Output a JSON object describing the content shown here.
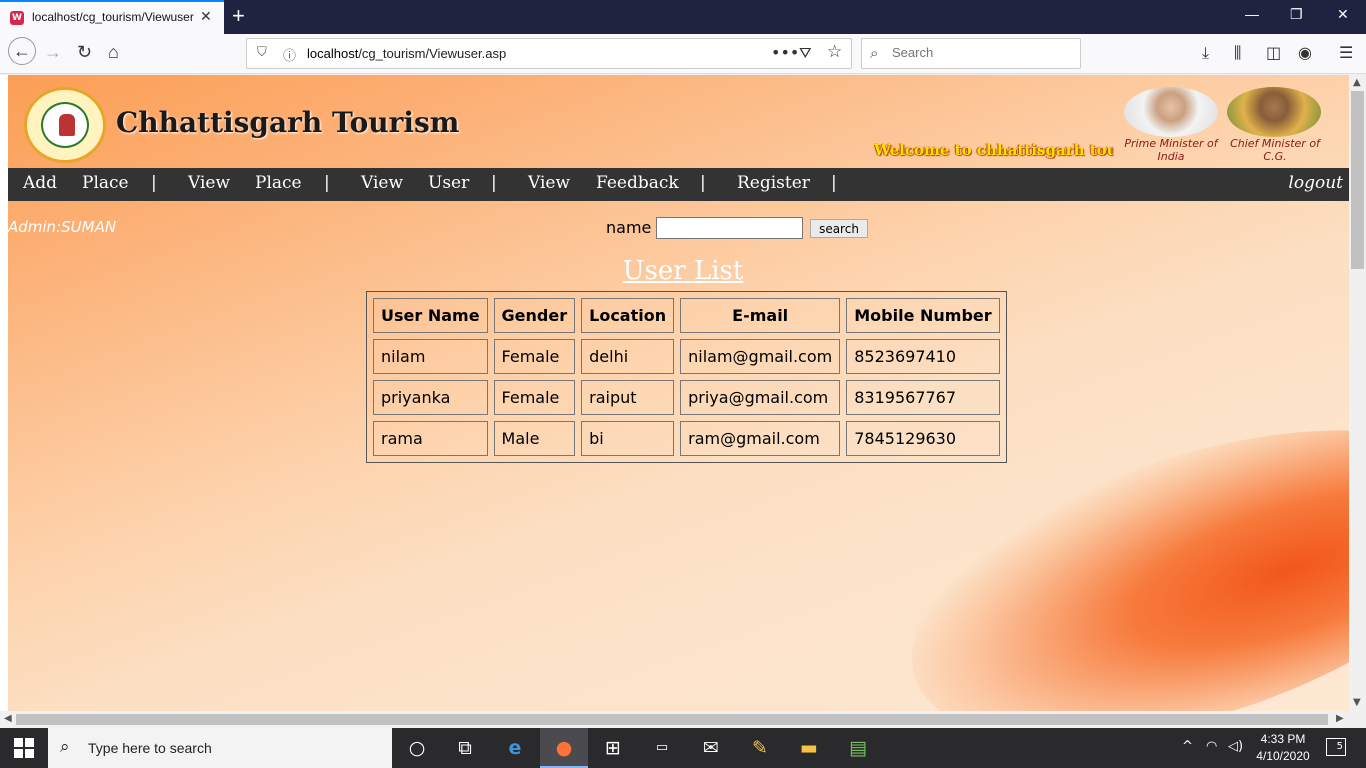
{
  "browser": {
    "tab_title": "localhost/cg_tourism/Viewuser.asp",
    "new_tab": "+",
    "url_host": "localhost",
    "url_path": "/cg_tourism/Viewuser.asp",
    "search_placeholder": "Search"
  },
  "page": {
    "site_title": "Chhattisgarh Tourism",
    "welcome_marquee": "Welcome to chhattisgarh tourism",
    "pm_caption": "Prime Minister of India",
    "cm_caption": "Chief Minister of C.G.",
    "menu": [
      {
        "label": "Add"
      },
      {
        "label": "Place"
      },
      {
        "label": "|"
      },
      {
        "label": "View"
      },
      {
        "label": "Place"
      },
      {
        "label": "|"
      },
      {
        "label": "View"
      },
      {
        "label": "User"
      },
      {
        "label": "|"
      },
      {
        "label": "View"
      },
      {
        "label": "Feedback"
      },
      {
        "label": "|"
      },
      {
        "label": "Register"
      },
      {
        "label": "|"
      }
    ],
    "logout": "logout",
    "admin": "Admin:SUMAN",
    "search_label": "name",
    "search_button": "search",
    "list_title": "User List",
    "table": {
      "headers": [
        "User Name",
        "Gender",
        "Location",
        "E-mail",
        "Mobile Number"
      ],
      "rows": [
        [
          "nilam",
          "Female",
          "delhi",
          "nilam@gmail.com",
          "8523697410"
        ],
        [
          "priyanka",
          "Female",
          "raiput",
          "priya@gmail.com",
          "8319567767"
        ],
        [
          "rama",
          "Male",
          "bi",
          "ram@gmail.com",
          "7845129630"
        ]
      ]
    }
  },
  "taskbar": {
    "search_placeholder": "Type here to search",
    "time": "4:33 PM",
    "date": "4/10/2020",
    "notifications": "5",
    "apps": [
      "task-view-icon",
      "edge-icon",
      "firefox-icon",
      "store-icon",
      "terminal-icon",
      "mail-icon",
      "paint-icon",
      "file-explorer-icon",
      "notepad-icon"
    ]
  },
  "colors": {
    "menu_bg": "#333333",
    "title_accent": "#ffe100",
    "tab_accent": "#0a84ff"
  }
}
